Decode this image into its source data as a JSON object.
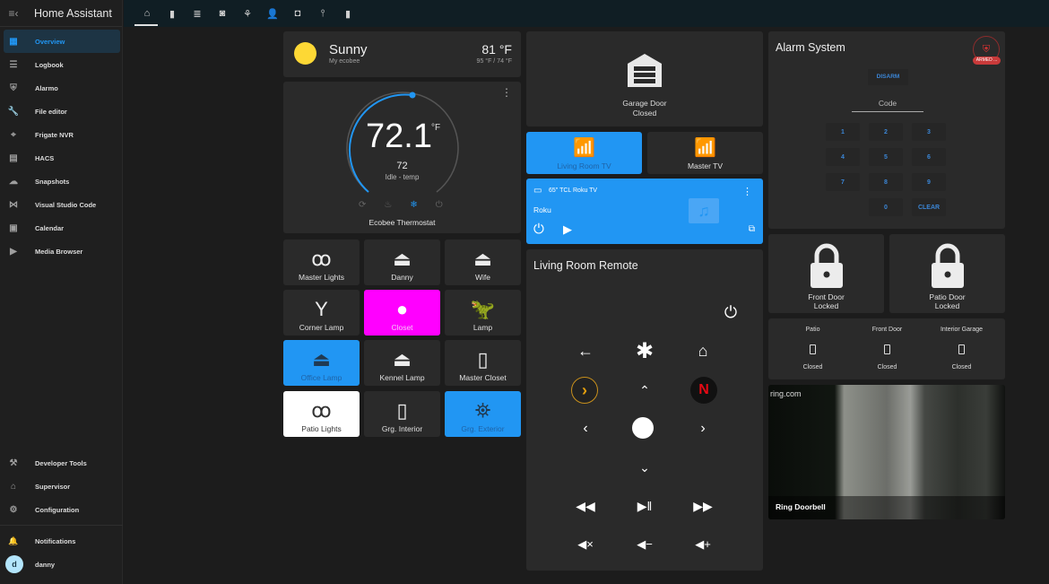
{
  "app": {
    "title": "Home Assistant"
  },
  "sidebar": {
    "items": [
      {
        "label": "Overview",
        "icon": "dashboard-icon",
        "glyph": "▦",
        "active": true
      },
      {
        "label": "Logbook",
        "icon": "logbook-icon",
        "glyph": "☰"
      },
      {
        "label": "Alarmo",
        "icon": "shield-icon",
        "glyph": "⛨"
      },
      {
        "label": "File editor",
        "icon": "wrench-icon",
        "glyph": "🔧"
      },
      {
        "label": "Frigate NVR",
        "icon": "cctv-icon",
        "glyph": "⌖"
      },
      {
        "label": "HACS",
        "icon": "hacs-icon",
        "glyph": "▤"
      },
      {
        "label": "Snapshots",
        "icon": "cloud-icon",
        "glyph": "☁"
      },
      {
        "label": "Visual Studio Code",
        "icon": "vscode-icon",
        "glyph": "⋈"
      },
      {
        "label": "Calendar",
        "icon": "calendar-icon",
        "glyph": "▣"
      },
      {
        "label": "Media Browser",
        "icon": "media-icon",
        "glyph": "▶"
      }
    ],
    "bottom_items": [
      {
        "label": "Developer Tools",
        "icon": "hammer-icon",
        "glyph": "⚒"
      },
      {
        "label": "Supervisor",
        "icon": "supervisor-icon",
        "glyph": "⌂"
      },
      {
        "label": "Configuration",
        "icon": "gear-icon",
        "glyph": "⚙"
      }
    ],
    "notifications": {
      "label": "Notifications",
      "glyph": "🔔"
    },
    "user": {
      "name": "danny",
      "initial": "d"
    }
  },
  "topbar": {
    "tabs": [
      {
        "name": "home",
        "glyph": "⌂"
      },
      {
        "name": "remote",
        "glyph": "▮"
      },
      {
        "name": "server",
        "glyph": "≣"
      },
      {
        "name": "robot",
        "glyph": "◙"
      },
      {
        "name": "plant",
        "glyph": "⚘"
      },
      {
        "name": "person",
        "glyph": "👤"
      },
      {
        "name": "camera",
        "glyph": "◘"
      },
      {
        "name": "sensor",
        "glyph": "⫯"
      },
      {
        "name": "remote-2",
        "glyph": "▮"
      }
    ]
  },
  "weather": {
    "condition": "Sunny",
    "source": "My ecobee",
    "temp": "81 °F",
    "high_low": "95 °F / 74 °F",
    "sun_color": "#fdd835"
  },
  "thermostat": {
    "current": "72.1",
    "unit": "°F",
    "target": "72",
    "status": "Idle - temp",
    "name": "Ecobee Thermostat",
    "modes": [
      "auto",
      "heat",
      "cool",
      "off"
    ],
    "active_mode": "cool",
    "accent": "#2196f3"
  },
  "light_tiles": [
    {
      "label": "Master Lights",
      "icon": "string-lights-icon",
      "glyph": "ꝏ",
      "state": "off"
    },
    {
      "label": "Danny",
      "icon": "lamp-icon",
      "glyph": "⏏",
      "state": "off"
    },
    {
      "label": "Wife",
      "icon": "lamp-icon",
      "glyph": "⏏",
      "state": "off"
    },
    {
      "label": "Corner Lamp",
      "icon": "floor-lamp-icon",
      "glyph": "Y",
      "state": "off"
    },
    {
      "label": "Closet",
      "icon": "bulb-icon",
      "glyph": "●",
      "state": "on",
      "color": "#ff00ff"
    },
    {
      "label": "Lamp",
      "icon": "dinosaur-icon",
      "glyph": "🦖",
      "state": "off"
    },
    {
      "label": "Office Lamp",
      "icon": "lamp-icon",
      "glyph": "⏏",
      "state": "on",
      "color": "#2196f3"
    },
    {
      "label": "Kennel Lamp",
      "icon": "lamp-icon",
      "glyph": "⏏",
      "state": "off"
    },
    {
      "label": "Master Closet",
      "icon": "light-switch-icon",
      "glyph": "▯",
      "state": "off"
    },
    {
      "label": "Patio Lights",
      "icon": "string-lights-icon",
      "glyph": "ꝏ",
      "state": "on",
      "color": "#ffffff"
    },
    {
      "label": "Grg. Interior",
      "icon": "light-switch-icon",
      "glyph": "▯",
      "state": "off"
    },
    {
      "label": "Grg. Exterior",
      "icon": "outdoor-lamp-icon",
      "glyph": "⛯",
      "state": "on",
      "color": "#2196f3"
    }
  ],
  "garage": {
    "name": "Garage Door",
    "state": "Closed"
  },
  "tv_tiles": [
    {
      "label": "Living Room TV",
      "state": "on"
    },
    {
      "label": "Master TV",
      "state": "off"
    }
  ],
  "media_player": {
    "device": "65\" TCL Roku TV",
    "source": "Roku"
  },
  "remote": {
    "title": "Living Room Remote"
  },
  "alarm": {
    "title": "Alarm System",
    "disarm_label": "DISARM",
    "code_label": "Code",
    "badge": "ARMED ...",
    "keys": [
      "1",
      "2",
      "3",
      "4",
      "5",
      "6",
      "7",
      "8",
      "9",
      "0"
    ],
    "clear_label": "CLEAR"
  },
  "locks": [
    {
      "name": "Front Door",
      "state": "Locked"
    },
    {
      "name": "Patio Door",
      "state": "Locked"
    }
  ],
  "doors": [
    {
      "name": "Patio",
      "state": "Closed"
    },
    {
      "name": "Front Door",
      "state": "Closed"
    },
    {
      "name": "Interior Garage",
      "state": "Closed"
    }
  ],
  "camera": {
    "name": "Ring Doorbell",
    "watermark": "ring.com"
  }
}
